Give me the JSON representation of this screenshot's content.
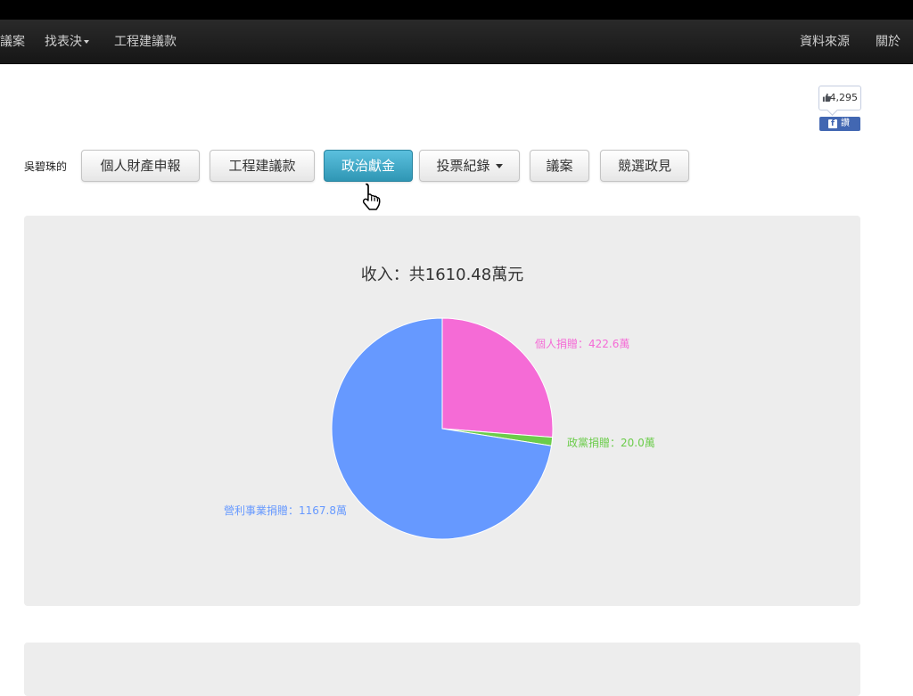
{
  "navbar": {
    "items_left": [
      {
        "label": "議案"
      },
      {
        "label": "找表決",
        "dropdown": true
      },
      {
        "label": "工程建議款"
      }
    ],
    "items_right": [
      {
        "label": "資料來源"
      },
      {
        "label": "關於"
      }
    ]
  },
  "facebook": {
    "like_count": "4,295",
    "share_label": "讚"
  },
  "person": {
    "label": "吳碧珠的"
  },
  "tabs": [
    {
      "label": "個人財產申報"
    },
    {
      "label": "工程建議款"
    },
    {
      "label": "政治獻金",
      "active": true
    },
    {
      "label": "投票紀錄",
      "dropdown": true
    },
    {
      "label": "議案"
    },
    {
      "label": "競選政見"
    }
  ],
  "chart_data": {
    "type": "pie",
    "title": "收入：共1610.48萬元",
    "slices": [
      {
        "name": "個人捐贈",
        "value": 422.6,
        "label": "個人捐贈：422.6萬",
        "color": "#f56bd6"
      },
      {
        "name": "政黨捐贈",
        "value": 20.0,
        "label": "政黨捐贈：20.0萬",
        "color": "#6bcc4a"
      },
      {
        "name": "營利事業捐贈",
        "value": 1167.8,
        "label": "營利事業捐贈：1167.8萬",
        "color": "#6699ff"
      }
    ]
  }
}
